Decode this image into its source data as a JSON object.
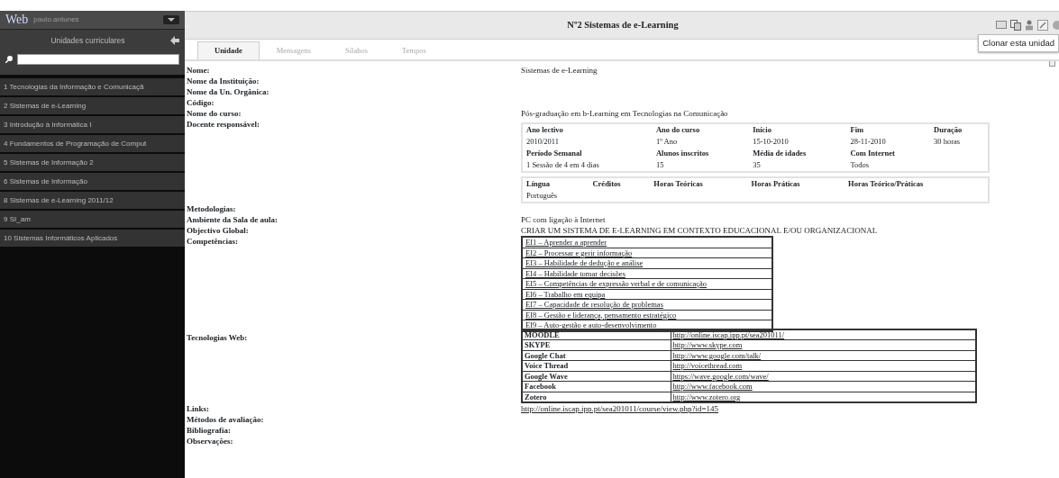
{
  "sidebar": {
    "logo": "Web",
    "user": "paulo.antunes",
    "heading": "Unidades curriculares",
    "items": [
      {
        "label": "1  Tecnologias da Informação e Comunicaçã"
      },
      {
        "label": "2  Sistemas de e-Learning"
      },
      {
        "label": "3  Introdução à Informática I"
      },
      {
        "label": "4  Fundamentos de Programação de Comput"
      },
      {
        "label": "5  Sistemas de Informação 2"
      },
      {
        "label": "6  Sistemas de Informação"
      },
      {
        "label": "8  Sistemas de e-Learning 2011/12"
      },
      {
        "label": "9  SI_am"
      },
      {
        "label": "10  Sistemas Informáticos Aplicados"
      }
    ]
  },
  "header": {
    "title": "Nº2 Sistemas de e-Learning",
    "tooltip": "Clonar esta unidad"
  },
  "tabs": [
    {
      "label": "Unidade",
      "selected": true
    },
    {
      "label": "Mensagens",
      "selected": false
    },
    {
      "label": "Sílabos",
      "selected": false
    },
    {
      "label": "Tempos",
      "selected": false
    }
  ],
  "fields": [
    {
      "label": "Nome:",
      "kind": "text",
      "value": "Sistemas de e-Learning"
    },
    {
      "label": "Nome da Instituição:",
      "kind": "empty"
    },
    {
      "label": "Nome da Un. Orgânica:",
      "kind": "empty"
    },
    {
      "label": "Código:",
      "kind": "empty"
    },
    {
      "label": "Nome do curso:",
      "kind": "text",
      "value": "Pós-graduação em b-Learning em Tecnologias na Comunicação"
    },
    {
      "label": "Docente responsável:",
      "kind": "info",
      "tables": [
        {
          "rows": [
            {
              "kind": "head",
              "cells": [
                "Ano lectivo",
                "Ano do curso",
                "Início",
                "Fim",
                "Duração"
              ]
            },
            {
              "kind": "data",
              "cells": [
                "2010/2011",
                "1º Ano",
                "15-10-2010",
                "28-11-2010",
                "30 horas"
              ]
            },
            {
              "kind": "head",
              "cells": [
                "Período Semanal",
                "Alunos inscritos",
                "Média de idades",
                "Com Internet"
              ]
            },
            {
              "kind": "data",
              "cells": [
                "1 Sessão de 4 em 4 dias",
                "15",
                "35",
                "Todos"
              ]
            }
          ]
        },
        {
          "rows": [
            {
              "kind": "head",
              "cells": [
                "Língua",
                "Créditos",
                "Horas Teóricas",
                "Horas Práticas",
                "Horas Teórico/Práticas"
              ]
            },
            {
              "kind": "data",
              "cells": [
                "Português"
              ]
            }
          ]
        }
      ]
    },
    {
      "label": "Metodologias:",
      "kind": "empty"
    },
    {
      "label": "Ambiente da Sala de aula:",
      "kind": "text",
      "value": "PC com ligação à Internet"
    },
    {
      "label": "Objectivo Global:",
      "kind": "text",
      "value": "CRIAR UM SISTEMA DE E-LEARNING EM CONTEXTO EDUCACIONAL E/OU ORGANIZACIONAL"
    },
    {
      "label": "Competências:",
      "kind": "list",
      "items": [
        "EI1 – Aprender a aprender",
        "EI2 – Processar e gerir informação",
        "EI3 – Habilidade de dedução e análise",
        "EI4 – Habilidade tomar decisões",
        "EI5 – Competências de expressão verbal e de comunicação",
        "EI6 – Trabalho em equipa",
        "EI7 – Capacidade de resolução de problemas",
        "EI8 – Gestão e liderança, pensamento estratégico",
        "EI9 – Auto-gestão e auto-desenvolvimento"
      ]
    },
    {
      "label": "Tecnologias Web:",
      "kind": "links",
      "rows": [
        {
          "name": "MOODLE",
          "url": "http://online.iscap.ipp.pt/sea201011/"
        },
        {
          "name": "SKYPE",
          "url": "http://www.skype.com"
        },
        {
          "name": "Google Chat",
          "url": "http://www.google.com/talk/"
        },
        {
          "name": "Voice Thread",
          "url": "http://voicethread.com"
        },
        {
          "name": "Google Wave",
          "url": "https://wave.google.com/wave/"
        },
        {
          "name": "Facebook",
          "url": "http://www.facebook.com"
        },
        {
          "name": "Zotero",
          "url": "http://www.zotero.org"
        }
      ]
    },
    {
      "label": "Links:",
      "kind": "link",
      "value": "http://online.iscap.ipp.pt/sea201011/course/view.php?id=145"
    },
    {
      "label": "Métodos de avaliação:",
      "kind": "empty"
    },
    {
      "label": "Bibliografia:",
      "kind": "empty"
    },
    {
      "label": "Observações:",
      "kind": "empty"
    }
  ]
}
